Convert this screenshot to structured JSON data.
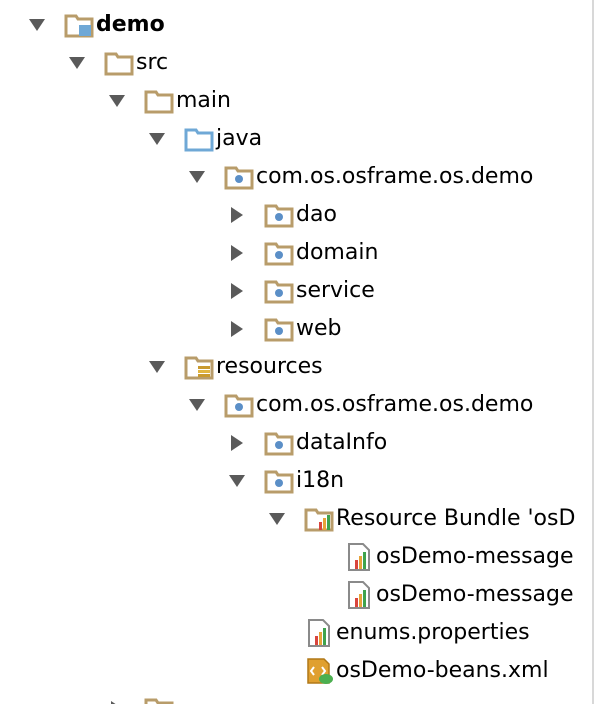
{
  "tree": {
    "rows": [
      {
        "label": "demo",
        "icon": "module-folder-icon",
        "arrow": "expanded",
        "bold": true
      },
      {
        "label": "src",
        "icon": "folder-icon",
        "arrow": "expanded"
      },
      {
        "label": "main",
        "icon": "folder-icon",
        "arrow": "expanded"
      },
      {
        "label": "java",
        "icon": "source-root-folder-icon",
        "arrow": "expanded"
      },
      {
        "label": "com.os.osframe.os.demo",
        "icon": "package-icon",
        "arrow": "expanded"
      },
      {
        "label": "dao",
        "icon": "package-icon",
        "arrow": "collapsed"
      },
      {
        "label": "domain",
        "icon": "package-icon",
        "arrow": "collapsed"
      },
      {
        "label": "service",
        "icon": "package-icon",
        "arrow": "collapsed"
      },
      {
        "label": "web",
        "icon": "package-icon",
        "arrow": "collapsed"
      },
      {
        "label": "resources",
        "icon": "resources-root-folder-icon",
        "arrow": "expanded"
      },
      {
        "label": "com.os.osframe.os.demo",
        "icon": "package-icon",
        "arrow": "expanded"
      },
      {
        "label": "dataInfo",
        "icon": "package-icon",
        "arrow": "collapsed"
      },
      {
        "label": "i18n",
        "icon": "package-icon",
        "arrow": "expanded"
      },
      {
        "label": "Resource Bundle 'osD",
        "icon": "resource-bundle-icon",
        "arrow": "expanded"
      },
      {
        "label": "osDemo-message",
        "icon": "properties-file-icon",
        "arrow": "none"
      },
      {
        "label": "osDemo-message",
        "icon": "properties-file-icon",
        "arrow": "none"
      },
      {
        "label": "enums.properties",
        "icon": "properties-file-icon",
        "arrow": "none"
      },
      {
        "label": "osDemo-beans.xml",
        "icon": "spring-xml-file-icon",
        "arrow": "none"
      },
      {
        "label": "",
        "icon": "folder-icon",
        "arrow": "collapsed"
      }
    ]
  },
  "colors": {
    "folder": "#b89c6a",
    "source_root": "#6fa8d6",
    "package_dot": "#5b8fc7",
    "arrow": "#5a5a5a",
    "bar_red": "#d9453d",
    "bar_orange": "#e8a33a",
    "bar_green": "#3fa34d",
    "xml_orange": "#e0a030",
    "xml_green": "#4caf50"
  }
}
